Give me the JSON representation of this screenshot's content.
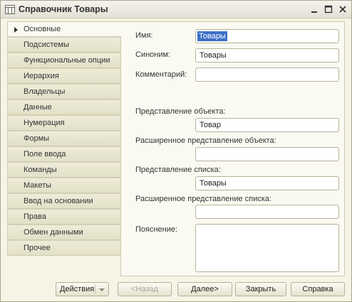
{
  "window": {
    "title": "Справочник Товары",
    "icon": "catalog-icon"
  },
  "sidebar": {
    "items": [
      {
        "label": "Основные",
        "active": true
      },
      {
        "label": "Подсистемы"
      },
      {
        "label": "Функциональные опции"
      },
      {
        "label": "Иерархия"
      },
      {
        "label": "Владельцы"
      },
      {
        "label": "Данные"
      },
      {
        "label": "Нумерация"
      },
      {
        "label": "Формы"
      },
      {
        "label": "Поле ввода"
      },
      {
        "label": "Команды"
      },
      {
        "label": "Макеты"
      },
      {
        "label": "Ввод на основании"
      },
      {
        "label": "Права"
      },
      {
        "label": "Обмен данными"
      },
      {
        "label": "Прочее"
      }
    ]
  },
  "form": {
    "name_label": "Имя:",
    "name_value": "Товары",
    "synonym_label": "Синоним:",
    "synonym_value": "Товары",
    "comment_label": "Комментарий:",
    "comment_value": "",
    "object_presentation_label": "Представление объекта:",
    "object_presentation_value": "Товар",
    "ext_object_presentation_label": "Расширенное представление объекта:",
    "ext_object_presentation_value": "",
    "list_presentation_label": "Представление списка:",
    "list_presentation_value": "Товары",
    "ext_list_presentation_label": "Расширенное представление списка:",
    "ext_list_presentation_value": "",
    "explanation_label": "Пояснение:",
    "explanation_value": ""
  },
  "buttons": {
    "actions": "Действия",
    "back": "<Назад",
    "next": "Далее>",
    "close": "Закрыть",
    "help": "Справка"
  },
  "colors": {
    "window_bg": "#f6f4e4",
    "selection": "#3d6fc7",
    "border": "#b5b29a"
  }
}
